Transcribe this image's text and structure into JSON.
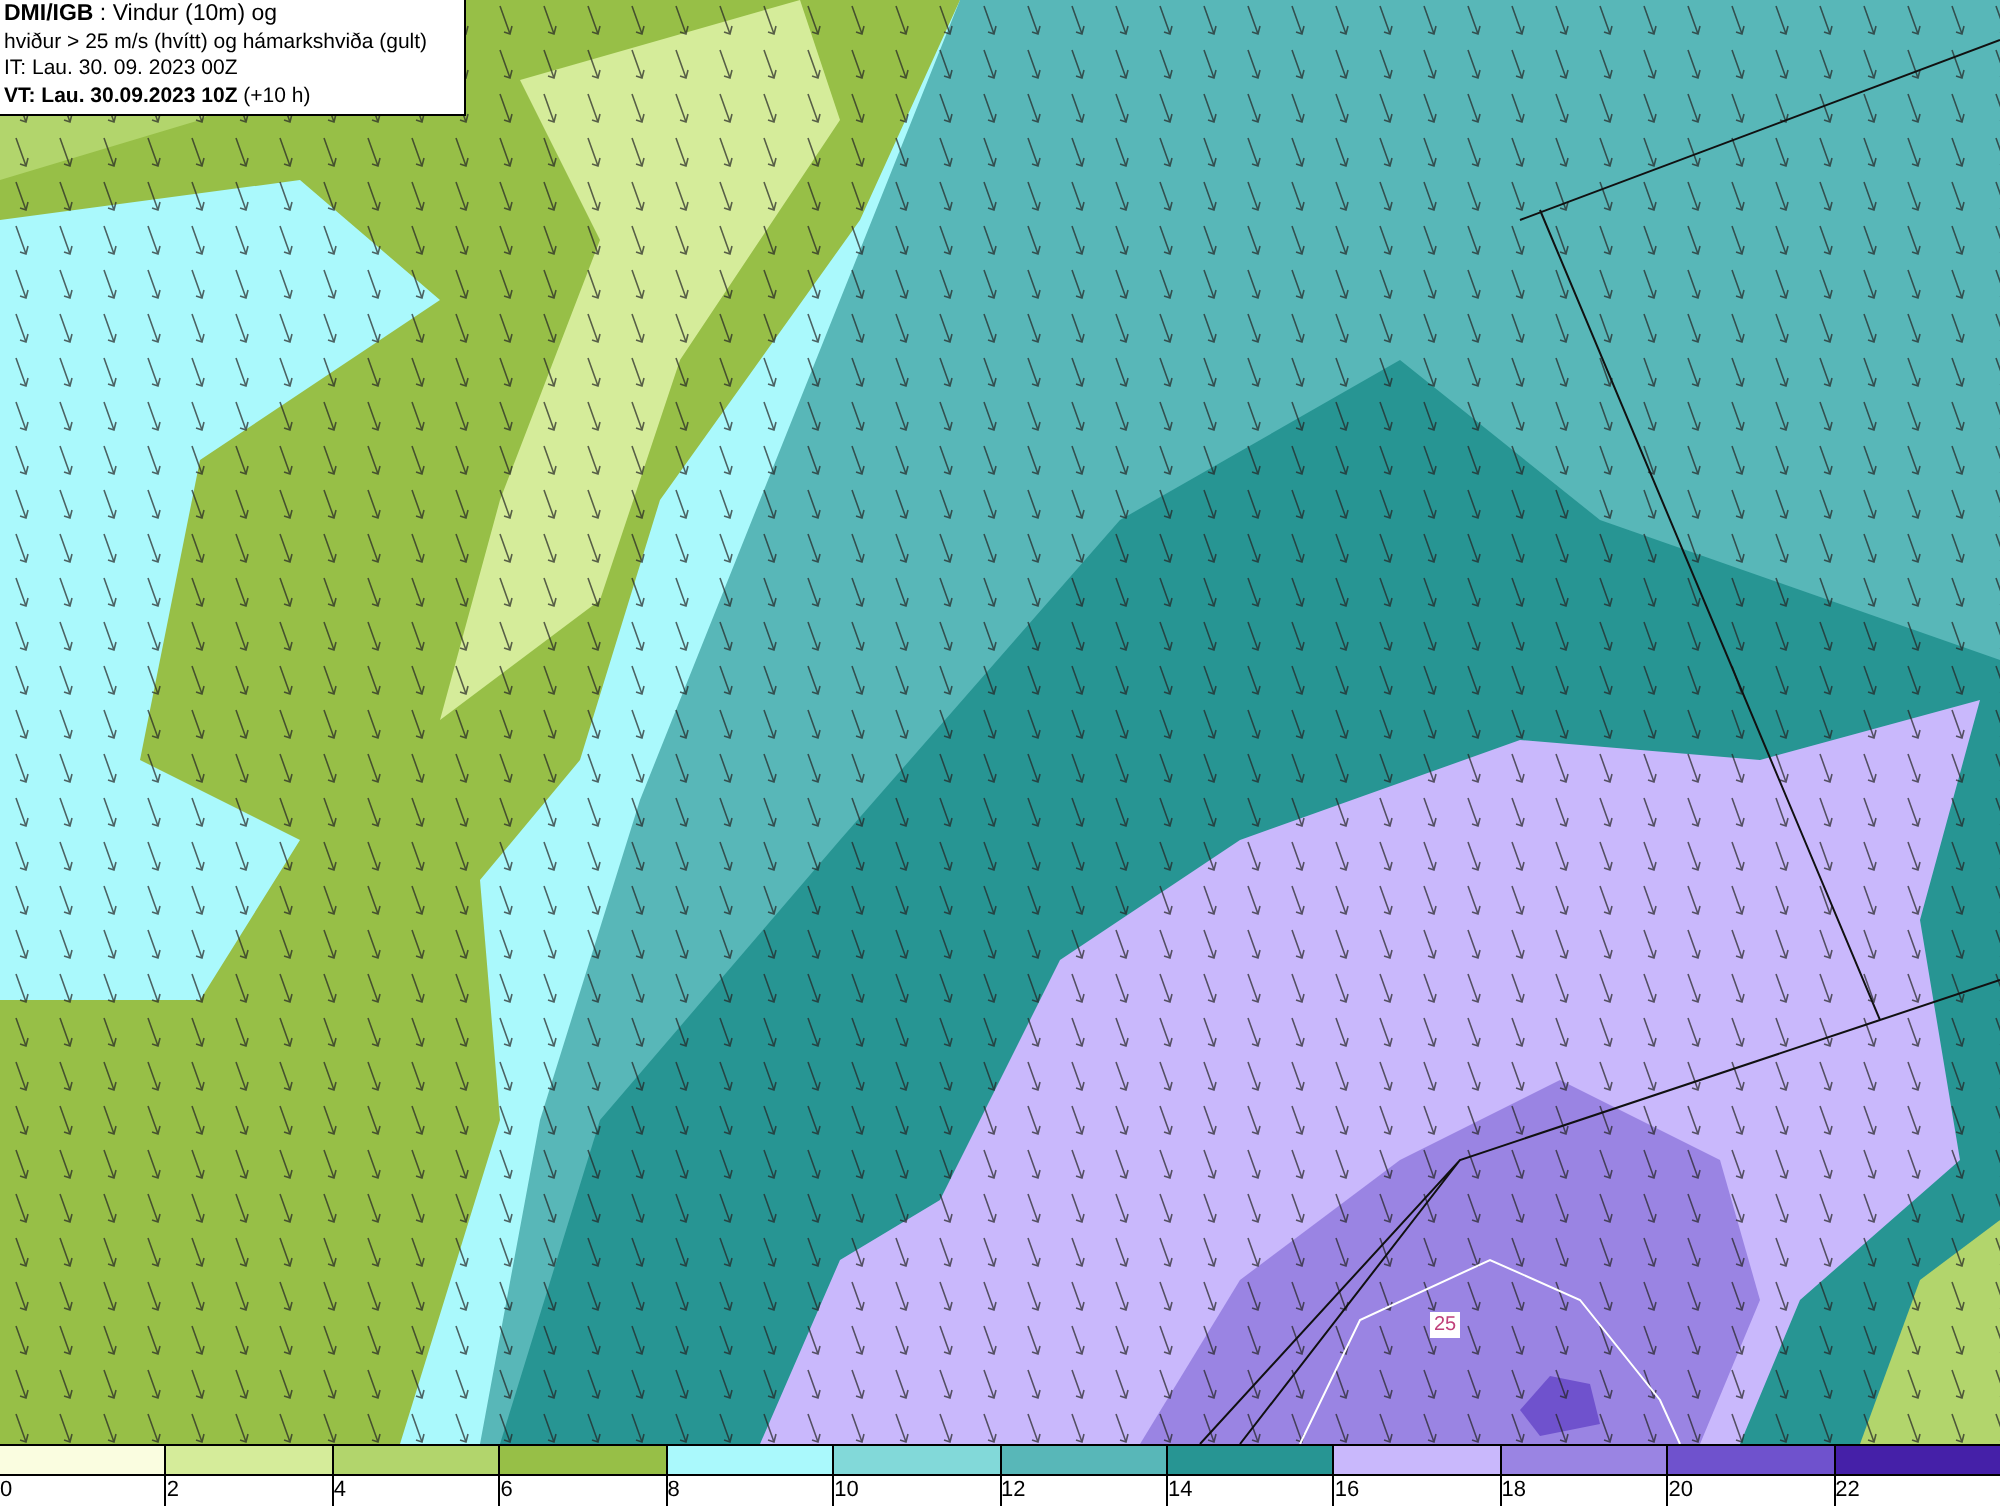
{
  "title_box": {
    "lines": [
      "**DMI/IGB** : Vindur (10m) og",
      "hviður > 25 m/s (hvítt) og hámarkshviða (gult)",
      "IT: Lau. 30. 09. 2023 00Z",
      "**VT: Lau. 30.09.2023 10Z** (+10 h)"
    ]
  },
  "map": {
    "contour_label": "25"
  },
  "legend": [
    {
      "label": "0",
      "color": "#fafde0"
    },
    {
      "label": "2",
      "color": "#d5ec9a"
    },
    {
      "label": "4",
      "color": "#b2d56c"
    },
    {
      "label": "6",
      "color": "#97bf47"
    },
    {
      "label": "8",
      "color": "#aaf9fc"
    },
    {
      "label": "10",
      "color": "#82d9d9"
    },
    {
      "label": "12",
      "color": "#58b7b8"
    },
    {
      "label": "14",
      "color": "#279593"
    },
    {
      "label": "16",
      "color": "#c9b8fc"
    },
    {
      "label": "18",
      "color": "#9a84e3"
    },
    {
      "label": "20",
      "color": "#6f52cd"
    },
    {
      "label": "22",
      "color": "#4520a8"
    }
  ]
}
